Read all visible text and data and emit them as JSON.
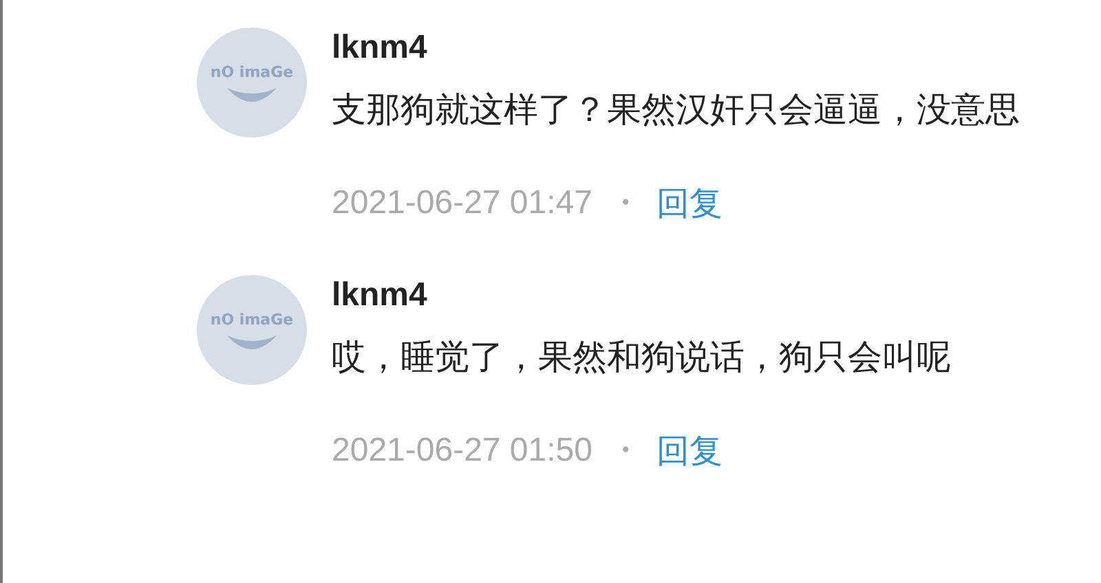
{
  "comments": [
    {
      "avatar_text": "nO imaGe",
      "author": "lknm4",
      "text": "支那狗就这样了？果然汉奸只会逼逼，没意思",
      "time": "2021-06-27 01:47",
      "separator": "•",
      "reply": "回复"
    },
    {
      "avatar_text": "nO imaGe",
      "author": "lknm4",
      "text": "哎，睡觉了，果然和狗说话，狗只会叫呢",
      "time": "2021-06-27 01:50",
      "separator": "•",
      "reply": "回复"
    }
  ]
}
